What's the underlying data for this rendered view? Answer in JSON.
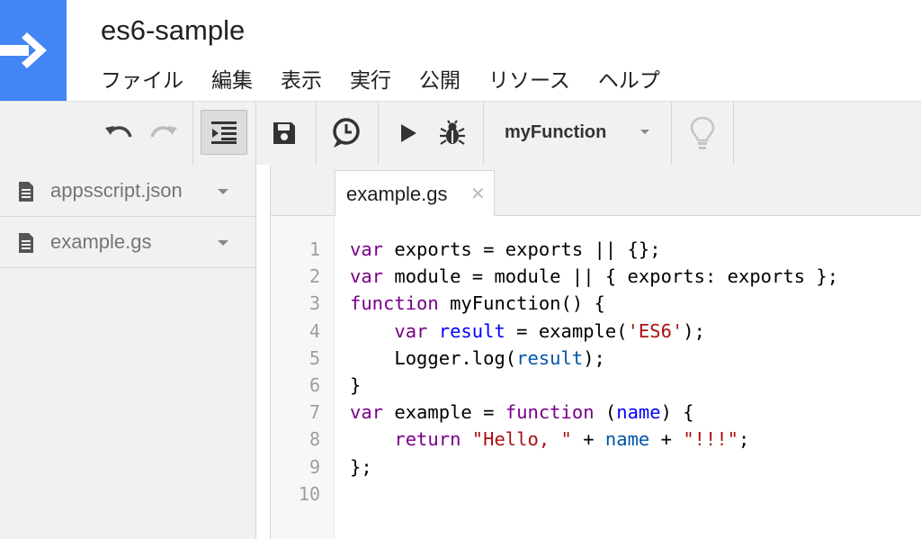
{
  "app": {
    "title": "es6-sample"
  },
  "menu": [
    "ファイル",
    "編集",
    "表示",
    "実行",
    "公開",
    "リソース",
    "ヘルプ"
  ],
  "toolbar": {
    "function_select": "myFunction",
    "icons": [
      "undo-icon",
      "redo-icon",
      "indent-icon",
      "save-icon",
      "triggers-icon",
      "run-icon",
      "debug-icon",
      "execution-hints-icon"
    ]
  },
  "files": [
    {
      "name": "appsscript.json"
    },
    {
      "name": "example.gs"
    }
  ],
  "editor": {
    "active_tab": "example.gs",
    "close_glyph": "✕",
    "line_numbers": [
      "1",
      "2",
      "3",
      "4",
      "5",
      "6",
      "7",
      "8",
      "9",
      "10"
    ],
    "lines": [
      [
        [
          "kw",
          "var"
        ],
        [
          "",
          "exports = exports || {};"
        ]
      ],
      [
        [
          "kw",
          "var"
        ],
        [
          "",
          "module = module || { exports: exports };"
        ]
      ],
      [
        [
          "kw",
          "function"
        ],
        [
          "",
          "myFunction() {"
        ]
      ],
      [
        [
          "",
          "    "
        ],
        [
          "kw",
          "var"
        ],
        [
          "",
          ""
        ],
        [
          "def",
          "result"
        ],
        [
          "",
          " = example("
        ],
        [
          "str",
          "'ES6'"
        ],
        [
          "",
          ");"
        ]
      ],
      [
        [
          "",
          "    Logger.log("
        ],
        [
          "var2",
          "result"
        ],
        [
          "",
          ");"
        ]
      ],
      [
        [
          "",
          "}"
        ]
      ],
      [
        [
          "kw",
          "var"
        ],
        [
          "",
          "example = "
        ],
        [
          "kw",
          "function"
        ],
        [
          "",
          " ("
        ],
        [
          "def",
          "name"
        ],
        [
          "",
          ") {"
        ]
      ],
      [
        [
          "",
          "    "
        ],
        [
          "kw",
          "return"
        ],
        [
          "",
          " "
        ],
        [
          "str",
          "\"Hello, \""
        ],
        [
          "",
          " + "
        ],
        [
          "var2",
          "name"
        ],
        [
          "",
          " + "
        ],
        [
          "str",
          "\"!!!\""
        ],
        [
          "",
          ";"
        ]
      ],
      [
        [
          "",
          "};"
        ]
      ],
      [
        [
          "",
          ""
        ]
      ]
    ]
  }
}
